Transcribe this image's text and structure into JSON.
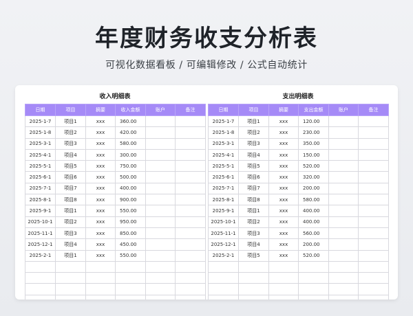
{
  "header": {
    "title": "年度财务收支分析表",
    "subtitle": "可视化数据看板 /  可编辑修改  /  公式自动统计"
  },
  "income": {
    "title": "收入明细表",
    "columns": [
      "日期",
      "项目",
      "摘要",
      "收入金额",
      "账户",
      "备注"
    ],
    "rows": [
      [
        "2025-1-7",
        "项目1",
        "xxx",
        "360.00",
        "",
        ""
      ],
      [
        "2025-1-8",
        "项目2",
        "xxx",
        "420.00",
        "",
        ""
      ],
      [
        "2025-3-1",
        "项目3",
        "xxx",
        "580.00",
        "",
        ""
      ],
      [
        "2025-4-1",
        "项目4",
        "xxx",
        "300.00",
        "",
        ""
      ],
      [
        "2025-5-1",
        "项目5",
        "xxx",
        "750.00",
        "",
        ""
      ],
      [
        "2025-6-1",
        "项目6",
        "xxx",
        "500.00",
        "",
        ""
      ],
      [
        "2025-7-1",
        "项目7",
        "xxx",
        "400.00",
        "",
        ""
      ],
      [
        "2025-8-1",
        "项目8",
        "xxx",
        "900.00",
        "",
        ""
      ],
      [
        "2025-9-1",
        "项目1",
        "xxx",
        "550.00",
        "",
        ""
      ],
      [
        "2025-10-1",
        "项目2",
        "xxx",
        "950.00",
        "",
        ""
      ],
      [
        "2025-11-1",
        "项目3",
        "xxx",
        "850.00",
        "",
        ""
      ],
      [
        "2025-12-1",
        "项目4",
        "xxx",
        "450.00",
        "",
        ""
      ],
      [
        "2025-2-1",
        "项目1",
        "xxx",
        "550.00",
        "",
        ""
      ],
      [
        "",
        "",
        "",
        "",
        "",
        ""
      ],
      [
        "",
        "",
        "",
        "",
        "",
        ""
      ],
      [
        "",
        "",
        "",
        "",
        "",
        ""
      ],
      [
        "",
        "",
        "",
        "",
        "",
        ""
      ]
    ]
  },
  "expense": {
    "title": "支出明细表",
    "columns": [
      "日期",
      "项目",
      "摘要",
      "支出金额",
      "账户",
      "备注"
    ],
    "rows": [
      [
        "2025-1-7",
        "项目1",
        "xxx",
        "120.00",
        "",
        ""
      ],
      [
        "2025-1-8",
        "项目2",
        "xxx",
        "230.00",
        "",
        ""
      ],
      [
        "2025-3-1",
        "项目3",
        "xxx",
        "350.00",
        "",
        ""
      ],
      [
        "2025-4-1",
        "项目4",
        "xxx",
        "150.00",
        "",
        ""
      ],
      [
        "2025-5-1",
        "项目5",
        "xxx",
        "520.00",
        "",
        ""
      ],
      [
        "2025-6-1",
        "项目6",
        "xxx",
        "320.00",
        "",
        ""
      ],
      [
        "2025-7-1",
        "项目7",
        "xxx",
        "200.00",
        "",
        ""
      ],
      [
        "2025-8-1",
        "项目8",
        "xxx",
        "580.00",
        "",
        ""
      ],
      [
        "2025-9-1",
        "项目1",
        "xxx",
        "400.00",
        "",
        ""
      ],
      [
        "2025-10-1",
        "项目2",
        "xxx",
        "400.00",
        "",
        ""
      ],
      [
        "2025-11-1",
        "项目3",
        "xxx",
        "560.00",
        "",
        ""
      ],
      [
        "2025-12-1",
        "项目4",
        "xxx",
        "200.00",
        "",
        ""
      ],
      [
        "2025-2-1",
        "项目5",
        "xxx",
        "520.00",
        "",
        ""
      ],
      [
        "",
        "",
        "",
        "",
        "",
        ""
      ],
      [
        "",
        "",
        "",
        "",
        "",
        ""
      ],
      [
        "",
        "",
        "",
        "",
        "",
        ""
      ],
      [
        "",
        "",
        "",
        "",
        "",
        ""
      ]
    ]
  },
  "colors": {
    "header_bg": "#a58af7",
    "header_text": "#ffffff",
    "grid": "#d8d8de"
  }
}
